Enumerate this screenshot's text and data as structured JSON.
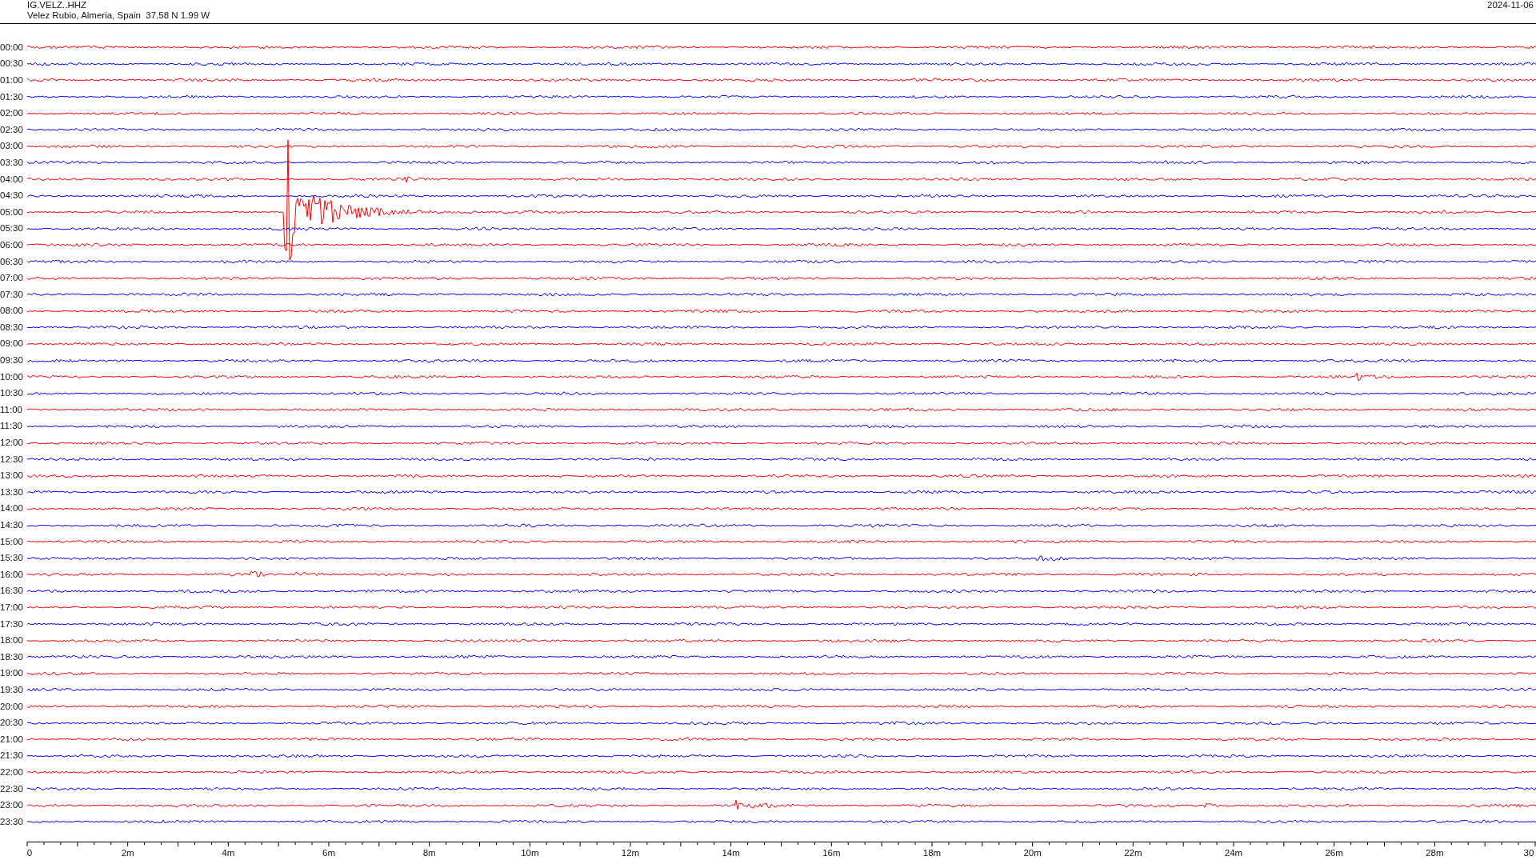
{
  "header": {
    "station": "IG.VELZ..HHZ",
    "location": "Velez Rubio, Almeria, Spain  37.58 N 1.99 W",
    "date": "2024-11-06"
  },
  "rows": [
    {
      "time": "00:00",
      "color": "#ff0000"
    },
    {
      "time": "00:30",
      "color": "#0000ff"
    },
    {
      "time": "01:00",
      "color": "#ff0000"
    },
    {
      "time": "01:30",
      "color": "#0000ff"
    },
    {
      "time": "02:00",
      "color": "#ff0000"
    },
    {
      "time": "02:30",
      "color": "#0000ff"
    },
    {
      "time": "03:00",
      "color": "#ff0000"
    },
    {
      "time": "03:30",
      "color": "#0000ff"
    },
    {
      "time": "04:00",
      "color": "#ff0000"
    },
    {
      "time": "04:30",
      "color": "#0000ff"
    },
    {
      "time": "05:00",
      "color": "#ff0000"
    },
    {
      "time": "05:30",
      "color": "#0000ff"
    },
    {
      "time": "06:00",
      "color": "#ff0000"
    },
    {
      "time": "06:30",
      "color": "#0000ff"
    },
    {
      "time": "07:00",
      "color": "#ff0000"
    },
    {
      "time": "07:30",
      "color": "#0000ff"
    },
    {
      "time": "08:00",
      "color": "#ff0000"
    },
    {
      "time": "08:30",
      "color": "#0000ff"
    },
    {
      "time": "09:00",
      "color": "#ff0000"
    },
    {
      "time": "09:30",
      "color": "#0000ff"
    },
    {
      "time": "10:00",
      "color": "#ff0000"
    },
    {
      "time": "10:30",
      "color": "#0000ff"
    },
    {
      "time": "11:00",
      "color": "#ff0000"
    },
    {
      "time": "11:30",
      "color": "#0000ff"
    },
    {
      "time": "12:00",
      "color": "#ff0000"
    },
    {
      "time": "12:30",
      "color": "#0000ff"
    },
    {
      "time": "13:00",
      "color": "#ff0000"
    },
    {
      "time": "13:30",
      "color": "#0000ff"
    },
    {
      "time": "14:00",
      "color": "#ff0000"
    },
    {
      "time": "14:30",
      "color": "#0000ff"
    },
    {
      "time": "15:00",
      "color": "#ff0000"
    },
    {
      "time": "15:30",
      "color": "#0000ff"
    },
    {
      "time": "16:00",
      "color": "#ff0000"
    },
    {
      "time": "16:30",
      "color": "#0000ff"
    },
    {
      "time": "17:00",
      "color": "#ff0000"
    },
    {
      "time": "17:30",
      "color": "#0000ff"
    },
    {
      "time": "18:00",
      "color": "#ff0000"
    },
    {
      "time": "18:30",
      "color": "#0000ff"
    },
    {
      "time": "19:00",
      "color": "#ff0000"
    },
    {
      "time": "19:30",
      "color": "#0000ff"
    },
    {
      "time": "20:00",
      "color": "#ff0000"
    },
    {
      "time": "20:30",
      "color": "#0000ff"
    },
    {
      "time": "21:00",
      "color": "#ff0000"
    },
    {
      "time": "21:30",
      "color": "#0000ff"
    },
    {
      "time": "22:00",
      "color": "#ff0000"
    },
    {
      "time": "22:30",
      "color": "#0000ff"
    },
    {
      "time": "23:00",
      "color": "#ff0000"
    },
    {
      "time": "23:30",
      "color": "#0000ff"
    }
  ],
  "axis": {
    "labels": [
      "0",
      "2m",
      "4m",
      "6m",
      "8m",
      "10m",
      "12m",
      "14m",
      "16m",
      "18m",
      "20m",
      "22m",
      "24m",
      "26m",
      "28m",
      "30"
    ]
  }
}
